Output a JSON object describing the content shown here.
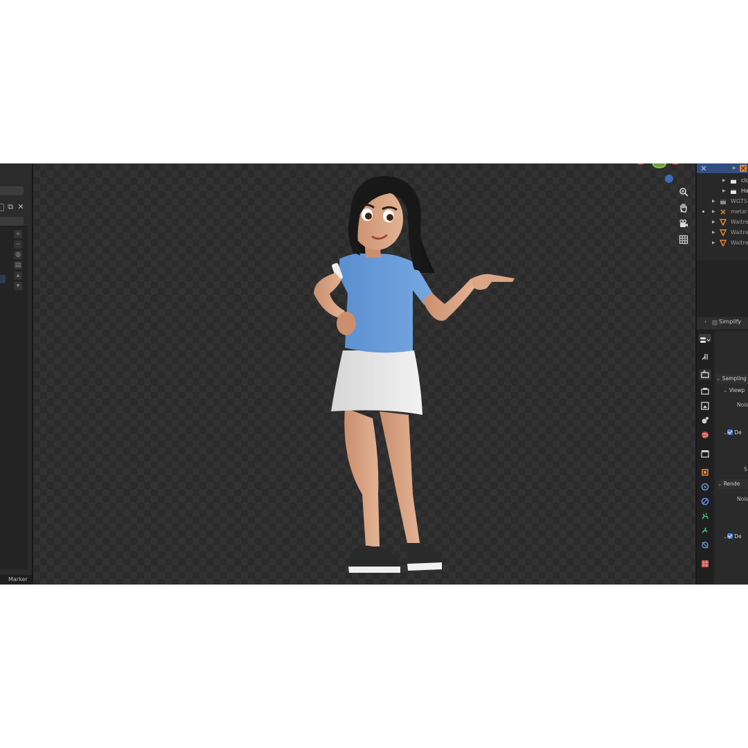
{
  "left_panel": {
    "marker_label": "Marker"
  },
  "outliner": {
    "rows": [
      {
        "label": "",
        "icon": "armature-icon",
        "selected": true
      },
      {
        "label": "clo",
        "icon": "collection-icon"
      },
      {
        "label": "Ha",
        "icon": "collection-icon"
      },
      {
        "label": "WGTS",
        "icon": "collection-icon"
      },
      {
        "label": "metar",
        "icon": "armature-icon"
      },
      {
        "label": "Waitre",
        "icon": "mesh-icon"
      },
      {
        "label": "Waitre",
        "icon": "mesh-icon"
      },
      {
        "label": "Waitre",
        "icon": "mesh-icon"
      }
    ]
  },
  "properties": {
    "simplify_label": "Simplify",
    "sampling_label": "Sampling",
    "viewport_label": "Viewp",
    "noise_label_1": "Nois",
    "denoise_label_1": "De",
    "s_label": "S",
    "render_label": "Rende",
    "noise_label_2": "Nois",
    "denoise_label_2": "De"
  },
  "colors": {
    "selection": "#334d80",
    "accent_blue": "#4a7fd1",
    "object_orange": "#e0883a",
    "physics_green": "#3ecf7a"
  }
}
